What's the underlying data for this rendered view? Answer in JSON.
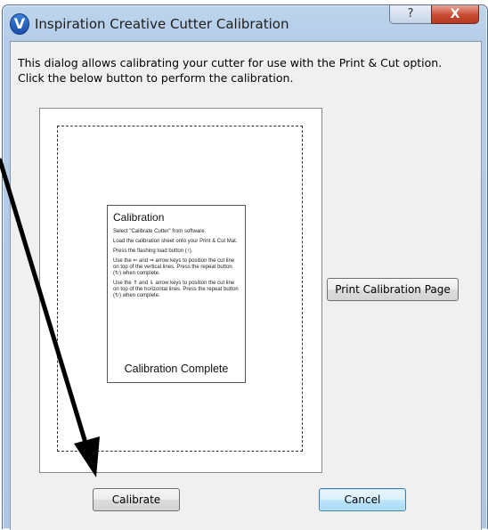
{
  "window": {
    "title": "Inspiration Creative Cutter Calibration",
    "help_label": "?",
    "close_label": "X",
    "app_icon_letter": "V",
    "app_icon": "inspiration-app-icon"
  },
  "dialog": {
    "description_line1": "This dialog allows calibrating your cutter for use with the Print & Cut option.",
    "description_line2": "Click the below button to perform the calibration."
  },
  "preview": {
    "card_title": "Calibration",
    "steps": [
      "Select \"Calibrate Cutter\" from software.",
      "Load the calibration sheet onto your Print & Cut Mat.",
      "Press the flashing load button (↑).",
      "Use the ⇐ and ⇒ arrow keys to position the cut line on top of the vertical lines. Press the repeat button (↻) when complete.",
      "Use the ⇑ and ⇓ arrow keys to position the cut line on top of the horizontal lines. Press the repeat button (↻) when complete."
    ],
    "card_footer": "Calibration Complete"
  },
  "buttons": {
    "print_calibration": "Print Calibration Page",
    "calibrate": "Calibrate",
    "cancel": "Cancel"
  },
  "colors": {
    "accent": "#3c7fb1",
    "close": "#c84b33",
    "arrow": "#000000"
  }
}
